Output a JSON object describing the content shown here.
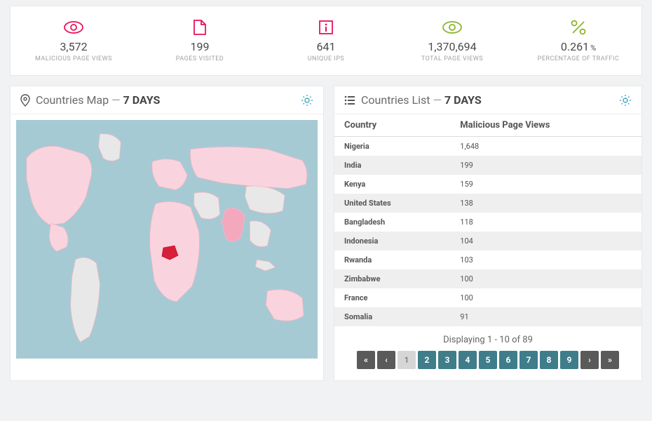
{
  "stats": {
    "malicious_views": {
      "value": "3,572",
      "label": "MALICIOUS PAGE VIEWS"
    },
    "pages_visited": {
      "value": "199",
      "label": "PAGES VISITED"
    },
    "unique_ips": {
      "value": "641",
      "label": "UNIQUE IPS"
    },
    "total_views": {
      "value": "1,370,694",
      "label": "TOTAL PAGE VIEWS"
    },
    "percentage": {
      "value": "0.261",
      "unit": "%",
      "label": "PERCENTAGE OF TRAFFIC"
    }
  },
  "map_panel": {
    "title": "Countries Map",
    "period": "7 DAYS"
  },
  "list_panel": {
    "title": "Countries List",
    "period": "7 DAYS"
  },
  "table": {
    "headers": {
      "country": "Country",
      "views": "Malicious Page Views"
    },
    "rows": [
      {
        "country": "Nigeria",
        "views": "1,648"
      },
      {
        "country": "India",
        "views": "199"
      },
      {
        "country": "Kenya",
        "views": "159"
      },
      {
        "country": "United States",
        "views": "138"
      },
      {
        "country": "Bangladesh",
        "views": "118"
      },
      {
        "country": "Indonesia",
        "views": "104"
      },
      {
        "country": "Rwanda",
        "views": "103"
      },
      {
        "country": "Zimbabwe",
        "views": "100"
      },
      {
        "country": "France",
        "views": "100"
      },
      {
        "country": "Somalia",
        "views": "91"
      }
    ]
  },
  "pagination": {
    "label": "Displaying 1 - 10 of 89",
    "first": "«",
    "prev": "‹",
    "next": "›",
    "last": "»",
    "pages": [
      "1",
      "2",
      "3",
      "4",
      "5",
      "6",
      "7",
      "8",
      "9"
    ],
    "current": "1"
  },
  "colors": {
    "pink": "#e8125d",
    "green": "#8bb42d",
    "teal": "#3f7d8a",
    "icon_teal": "#4aa7c0"
  }
}
